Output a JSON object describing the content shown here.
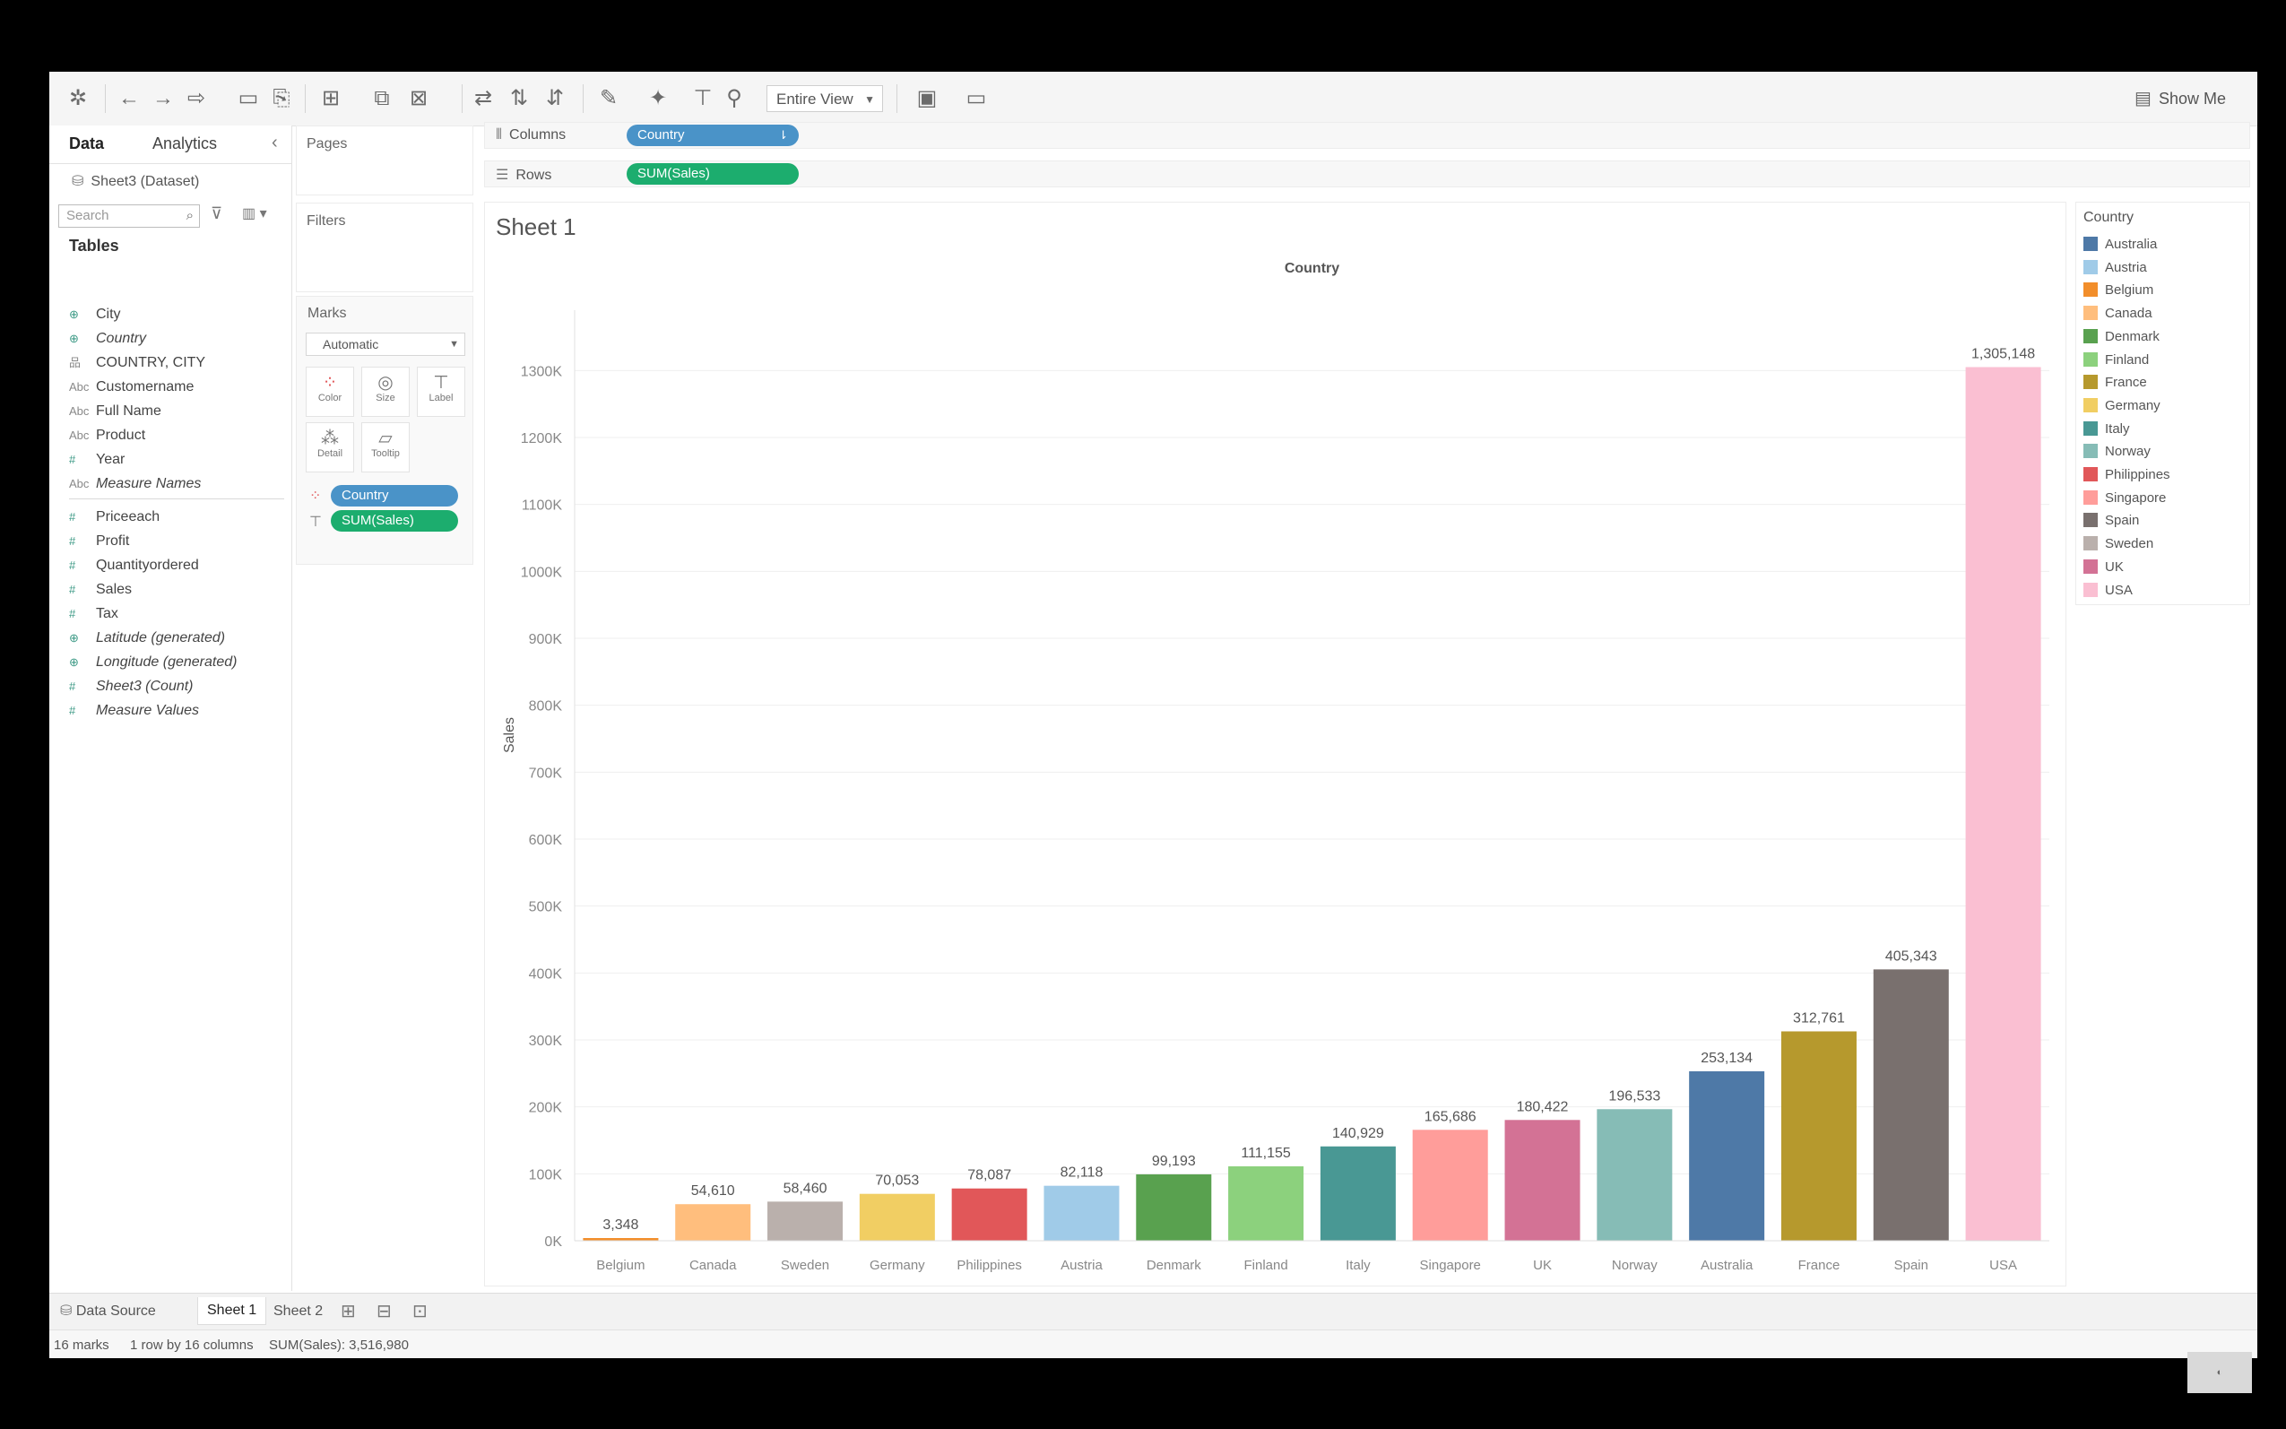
{
  "toolbar": {
    "view_select": "Entire View",
    "show_me": "Show Me"
  },
  "datapane": {
    "tab_data": "Data",
    "tab_analytics": "Analytics",
    "dataset": "Sheet3 (Dataset)",
    "search_placeholder": "Search",
    "tables_title": "Tables",
    "fields": [
      {
        "type": "geo",
        "icon": "⊕",
        "label": "City"
      },
      {
        "type": "geo",
        "icon": "⊕",
        "label": "Country"
      },
      {
        "type": "hier",
        "icon": "品",
        "label": "COUNTRY, CITY"
      },
      {
        "type": "abc",
        "icon": "Abc",
        "label": "Customername"
      },
      {
        "type": "abc",
        "icon": "Abc",
        "label": "Full Name"
      },
      {
        "type": "abc",
        "icon": "Abc",
        "label": "Product"
      },
      {
        "type": "num",
        "icon": "#",
        "label": "Year"
      },
      {
        "type": "abc",
        "icon": "Abc",
        "label": "Measure Names"
      }
    ],
    "measures": [
      {
        "type": "num",
        "icon": "#",
        "label": "Priceeach"
      },
      {
        "type": "num",
        "icon": "#",
        "label": "Profit"
      },
      {
        "type": "num",
        "icon": "#",
        "label": "Quantityordered"
      },
      {
        "type": "num",
        "icon": "#",
        "label": "Sales"
      },
      {
        "type": "num",
        "icon": "#",
        "label": "Tax"
      },
      {
        "type": "geo",
        "icon": "⊕",
        "label": "Latitude (generated)"
      },
      {
        "type": "geo",
        "icon": "⊕",
        "label": "Longitude (generated)"
      },
      {
        "type": "num",
        "icon": "#",
        "label": "Sheet3 (Count)"
      },
      {
        "type": "num",
        "icon": "#",
        "label": "Measure Values"
      }
    ]
  },
  "cards": {
    "pages": "Pages",
    "filters": "Filters",
    "marks": "Marks",
    "mark_type": "Automatic",
    "buttons": [
      "Color",
      "Size",
      "Label",
      "Detail",
      "Tooltip"
    ],
    "pill_color": "Country",
    "pill_label": "SUM(Sales)"
  },
  "shelves": {
    "columns_label": "Columns",
    "columns_pill": "Country",
    "rows_label": "Rows",
    "rows_pill": "SUM(Sales)"
  },
  "sheet": {
    "title": "Sheet 1"
  },
  "colors": {
    "dimension_pill": "#4a93c8",
    "measure_pill": "#1cad6e"
  },
  "chart_data": {
    "type": "bar",
    "title": "Country",
    "xlabel": "",
    "ylabel": "Sales",
    "ylim": [
      0,
      1350000
    ],
    "y_ticks": [
      0,
      100000,
      200000,
      300000,
      400000,
      500000,
      600000,
      700000,
      800000,
      900000,
      1000000,
      1100000,
      1200000,
      1300000
    ],
    "y_tick_labels": [
      "0K",
      "100K",
      "200K",
      "300K",
      "400K",
      "500K",
      "600K",
      "700K",
      "800K",
      "900K",
      "1000K",
      "1100K",
      "1200K",
      "1300K"
    ],
    "grid": true,
    "categories": [
      "Belgium",
      "Canada",
      "Sweden",
      "Germany",
      "Philippines",
      "Austria",
      "Denmark",
      "Finland",
      "Italy",
      "Singapore",
      "UK",
      "Norway",
      "Australia",
      "France",
      "Spain",
      "USA"
    ],
    "values": [
      3348,
      54610,
      58460,
      70053,
      78087,
      82118,
      99193,
      111155,
      140929,
      165686,
      180422,
      196533,
      253134,
      312761,
      405343,
      1305148
    ],
    "value_labels": [
      "3,348",
      "54,610",
      "58,460",
      "70,053",
      "78,087",
      "82,118",
      "99,193",
      "111,155",
      "140,929",
      "165,686",
      "180,422",
      "196,533",
      "253,134",
      "312,761",
      "405,343",
      "1,305,148"
    ],
    "bar_colors": [
      "#f28e2b",
      "#ffbe7d",
      "#bab0ac",
      "#f1ce63",
      "#e15759",
      "#a0cbe8",
      "#59a14f",
      "#8cd17d",
      "#499894",
      "#ff9d9a",
      "#d37295",
      "#86bcb6",
      "#4e79a7",
      "#b6992d",
      "#79706e",
      "#fabfd2"
    ],
    "legend_title": "Country",
    "legend_placement": "right",
    "legend": [
      {
        "name": "Australia",
        "color": "#4e79a7"
      },
      {
        "name": "Austria",
        "color": "#a0cbe8"
      },
      {
        "name": "Belgium",
        "color": "#f28e2b"
      },
      {
        "name": "Canada",
        "color": "#ffbe7d"
      },
      {
        "name": "Denmark",
        "color": "#59a14f"
      },
      {
        "name": "Finland",
        "color": "#8cd17d"
      },
      {
        "name": "France",
        "color": "#b6992d"
      },
      {
        "name": "Germany",
        "color": "#f1ce63"
      },
      {
        "name": "Italy",
        "color": "#499894"
      },
      {
        "name": "Norway",
        "color": "#86bcb6"
      },
      {
        "name": "Philippines",
        "color": "#e15759"
      },
      {
        "name": "Singapore",
        "color": "#ff9d9a"
      },
      {
        "name": "Spain",
        "color": "#79706e"
      },
      {
        "name": "Sweden",
        "color": "#bab0ac"
      },
      {
        "name": "UK",
        "color": "#d37295"
      },
      {
        "name": "USA",
        "color": "#fabfd2"
      }
    ]
  },
  "bottom": {
    "data_source": "Data Source",
    "sheet1": "Sheet 1",
    "sheet2": "Sheet 2"
  },
  "status": {
    "marks": "16 marks",
    "rows_cols": "1 row by 16 columns",
    "sum": "SUM(Sales): 3,516,980"
  }
}
